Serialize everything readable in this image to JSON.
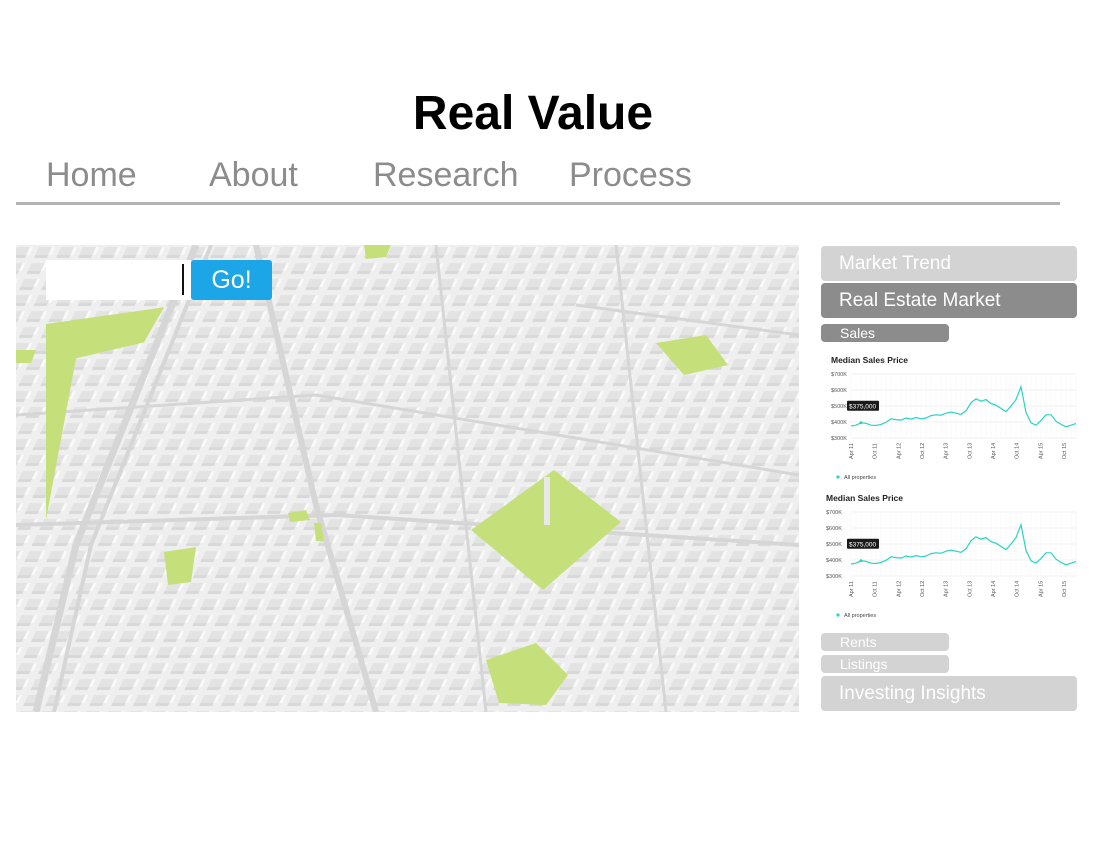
{
  "header": {
    "title": "Real Value"
  },
  "nav": {
    "items": [
      "Home",
      "About",
      "Research",
      "Process"
    ]
  },
  "search": {
    "value": "",
    "button_label": "Go!"
  },
  "colors": {
    "accent": "#1ca6e8",
    "park": "#c5e07a",
    "line": "#2ad3c2",
    "panel_light": "#d3d3d3",
    "panel_dark": "#8c8c8c"
  },
  "map": {
    "icon": "city-3d-map"
  },
  "sidebar": {
    "market_trend": "Market Trend",
    "real_estate_market": "Real Estate Market",
    "sales": "Sales",
    "rents": "Rents",
    "listings": "Listings",
    "investing_insights": "Investing Insights"
  },
  "chart_data": [
    {
      "type": "line",
      "title": "Median Sales Price",
      "y_ticks": [
        "$700K",
        "$600K",
        "$500K",
        "$400K",
        "$300K"
      ],
      "ylim": [
        300000,
        700000
      ],
      "x_ticks": [
        "Apr 11",
        "Oct 11",
        "Apr 12",
        "Oct 12",
        "Apr 13",
        "Oct 13",
        "Apr 14",
        "Oct 14",
        "Apr 15",
        "Oct 15"
      ],
      "tooltip": "$375,000",
      "legend": "All properties",
      "series": [
        {
          "values": [
            375000,
            380000,
            395000,
            392000,
            380000,
            378000,
            385000,
            398000,
            420000,
            415000,
            412000,
            425000,
            418000,
            428000,
            420000,
            425000,
            440000,
            445000,
            442000,
            455000,
            462000,
            455000,
            448000,
            470000,
            520000,
            545000,
            530000,
            540000,
            515000,
            505000,
            485000,
            465000,
            500000,
            540000,
            620000,
            460000,
            395000,
            380000,
            410000,
            445000,
            445000,
            405000,
            385000,
            370000,
            380000,
            390000
          ]
        }
      ]
    },
    {
      "type": "line",
      "title": "Median Sales Price",
      "y_ticks": [
        "$700K",
        "$600K",
        "$500K",
        "$400K",
        "$300K"
      ],
      "ylim": [
        300000,
        700000
      ],
      "x_ticks": [
        "Apr 11",
        "Oct 11",
        "Apr 12",
        "Oct 12",
        "Apr 13",
        "Oct 13",
        "Apr 14",
        "Oct 14",
        "Apr 15",
        "Oct 15"
      ],
      "tooltip": "$375,000",
      "legend": "All properties",
      "series": [
        {
          "values": [
            375000,
            380000,
            395000,
            392000,
            380000,
            378000,
            385000,
            398000,
            420000,
            415000,
            412000,
            425000,
            418000,
            428000,
            420000,
            425000,
            440000,
            445000,
            442000,
            455000,
            462000,
            455000,
            448000,
            470000,
            520000,
            545000,
            530000,
            540000,
            515000,
            505000,
            485000,
            465000,
            500000,
            540000,
            620000,
            460000,
            395000,
            380000,
            410000,
            445000,
            445000,
            405000,
            385000,
            370000,
            380000,
            390000
          ]
        }
      ]
    }
  ]
}
